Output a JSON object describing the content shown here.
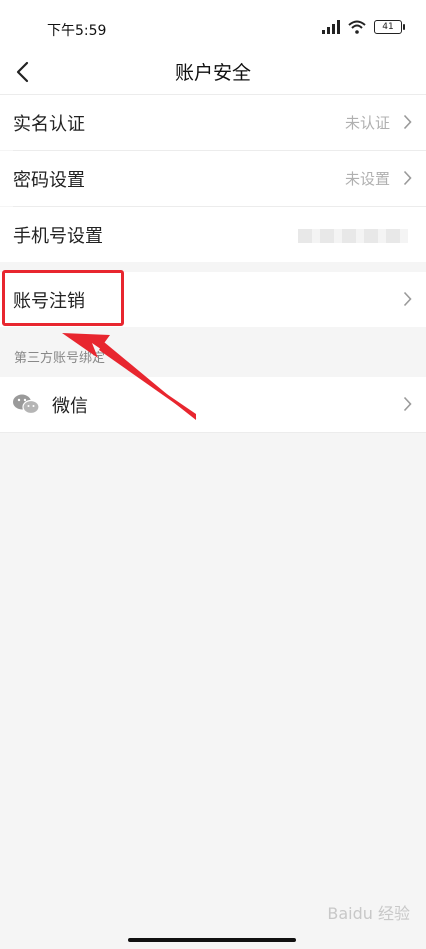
{
  "status_bar": {
    "time": "下午5:59",
    "battery": "41"
  },
  "header": {
    "title": "账户安全"
  },
  "rows": [
    {
      "label": "实名认证",
      "value": "未认证"
    },
    {
      "label": "密码设置",
      "value": "未设置"
    },
    {
      "label": "手机号设置"
    }
  ],
  "account_cancel": {
    "label": "账号注销"
  },
  "third_party": {
    "section_label": "第三方账号绑定",
    "items": [
      {
        "label": "微信"
      }
    ]
  },
  "watermark": "Baidu 经验",
  "colors": {
    "highlight": "#e8262f",
    "background": "#f5f5f5"
  },
  "icons": [
    "back-arrow-icon",
    "chevron-right-icon",
    "wechat-icon",
    "signal-icon",
    "wifi-icon",
    "battery-icon"
  ]
}
